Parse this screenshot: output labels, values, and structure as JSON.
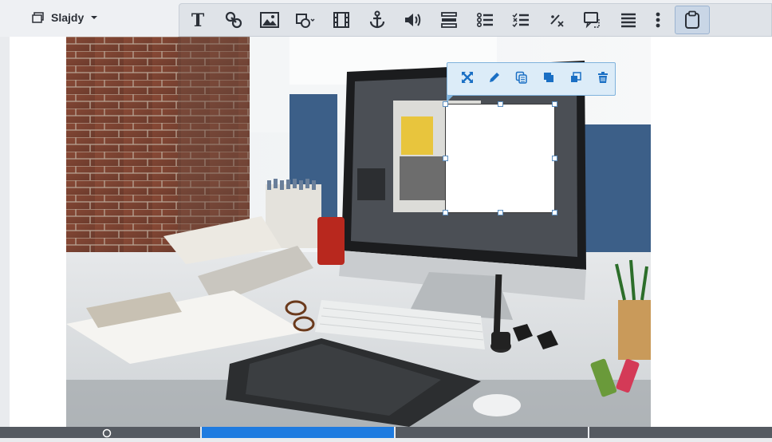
{
  "slides_menu": {
    "label": "Slajdy",
    "icon": "slides-icon",
    "caret": "chevron-down-icon"
  },
  "toolbar": {
    "items": [
      {
        "name": "text",
        "icon": "text-icon",
        "glyph": "T"
      },
      {
        "name": "link",
        "icon": "link-icon"
      },
      {
        "name": "image",
        "icon": "image-icon"
      },
      {
        "name": "shape",
        "icon": "shape-icon"
      },
      {
        "name": "video",
        "icon": "film-icon"
      },
      {
        "name": "anchor",
        "icon": "anchor-icon"
      },
      {
        "name": "audio",
        "icon": "speaker-icon"
      },
      {
        "name": "form",
        "icon": "form-fields-icon"
      },
      {
        "name": "list",
        "icon": "bullet-list-icon"
      },
      {
        "name": "checklist",
        "icon": "checklist-icon"
      },
      {
        "name": "math",
        "icon": "formula-icon"
      },
      {
        "name": "tooltip",
        "icon": "tooltip-shape-icon"
      },
      {
        "name": "menu",
        "icon": "list-menu-icon"
      },
      {
        "name": "more",
        "icon": "more-vertical-icon"
      },
      {
        "name": "clipboard",
        "icon": "clipboard-icon",
        "active": true
      }
    ]
  },
  "floating_toolbar": {
    "items": [
      {
        "name": "fullscreen",
        "icon": "expand-icon"
      },
      {
        "name": "edit",
        "icon": "pencil-icon"
      },
      {
        "name": "duplicate",
        "icon": "copy-icon"
      },
      {
        "name": "bring-front",
        "icon": "bring-front-icon"
      },
      {
        "name": "send-back",
        "icon": "send-back-icon"
      },
      {
        "name": "delete",
        "icon": "trash-icon"
      }
    ]
  },
  "colors": {
    "accent": "#1e7be0",
    "toolbar_icon": "#2b3038",
    "float_icon": "#1a6fc4"
  }
}
